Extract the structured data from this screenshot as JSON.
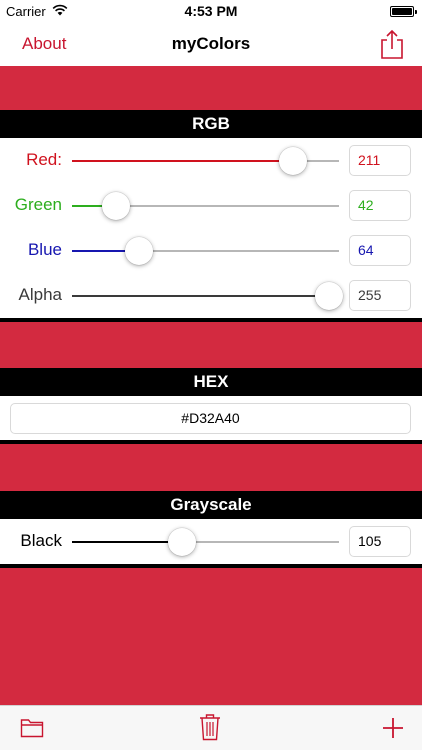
{
  "status_bar": {
    "carrier": "Carrier",
    "time": "4:53 PM"
  },
  "nav": {
    "about_label": "About",
    "title": "myColors"
  },
  "colors": {
    "current": "#D32A40",
    "accent": "#C8152F",
    "red": "#D0121E",
    "green": "#2DAE1E",
    "blue": "#1717B0",
    "alpha": "#3A3A3A"
  },
  "rgb": {
    "header": "RGB",
    "rows": [
      {
        "label": "Red:",
        "value": "211",
        "fraction": 0.827,
        "color": "#D0121E"
      },
      {
        "label": "Green",
        "value": "42",
        "fraction": 0.165,
        "color": "#2DAE1E"
      },
      {
        "label": "Blue",
        "value": "64",
        "fraction": 0.251,
        "color": "#1717B0"
      },
      {
        "label": "Alpha",
        "value": "255",
        "fraction": 1.0,
        "color": "#3A3A3A"
      }
    ]
  },
  "hex": {
    "header": "HEX",
    "value": "#D32A40"
  },
  "grayscale": {
    "header": "Grayscale",
    "label": "Black",
    "value": "105",
    "fraction": 0.412
  },
  "toolbar": {
    "icons": [
      "folder-icon",
      "trash-icon",
      "plus-icon"
    ]
  }
}
